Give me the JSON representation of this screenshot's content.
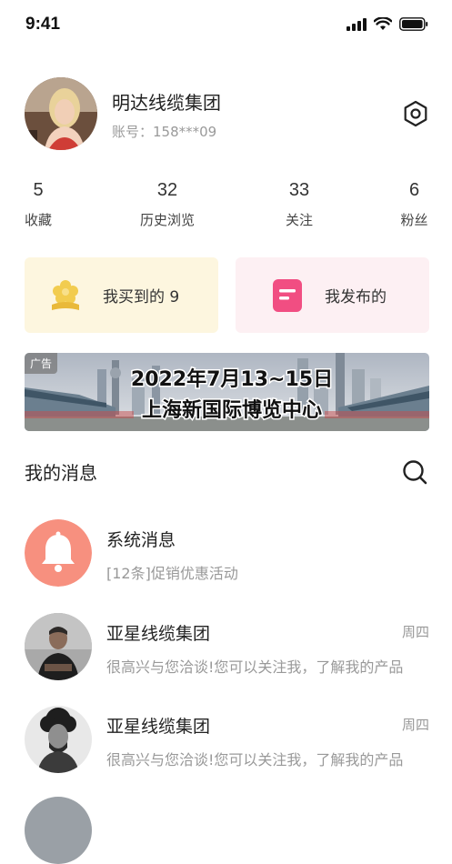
{
  "status_bar": {
    "time": "9:41"
  },
  "profile": {
    "name": "明达线缆集团",
    "account": "账号：158***09"
  },
  "stats": [
    {
      "value": "5",
      "label": "收藏"
    },
    {
      "value": "32",
      "label": "历史浏览"
    },
    {
      "value": "33",
      "label": "关注"
    },
    {
      "value": "6",
      "label": "粉丝"
    }
  ],
  "cards": {
    "bought": "我买到的 9",
    "published": "我发布的"
  },
  "banner": {
    "ad_tag": "广告",
    "line1": "2022年7月13~15日",
    "line2": "上海新国际博览中心"
  },
  "messages_section": {
    "title": "我的消息"
  },
  "messages": [
    {
      "title": "系统消息",
      "subtitle": "[12条]促销优惠活动",
      "date": ""
    },
    {
      "title": "亚星线缆集团",
      "subtitle": "很高兴与您洽谈!您可以关注我，了解我的产品",
      "date": "周四"
    },
    {
      "title": "亚星线缆集团",
      "subtitle": "很高兴与您洽谈!您可以关注我，了解我的产品",
      "date": "周四"
    }
  ],
  "colors": {
    "accent_pink": "#f14e82",
    "system_icon_bg": "#f7907f",
    "flower_yellow": "#f2cc4f"
  }
}
